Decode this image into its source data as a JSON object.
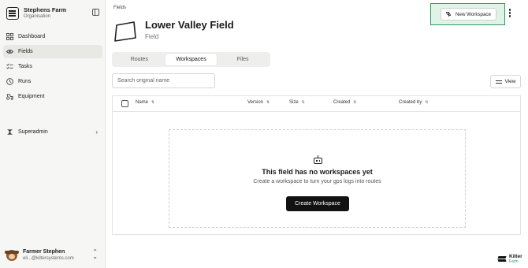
{
  "sidebar": {
    "org": {
      "name": "Stephens Farm",
      "subtitle": "Organisation"
    },
    "nav": [
      {
        "label": "Dashboard",
        "icon": "dashboard-grid-icon",
        "active": false
      },
      {
        "label": "Fields",
        "icon": "eye-field-icon",
        "active": true
      },
      {
        "label": "Tasks",
        "icon": "tasks-list-icon",
        "active": false
      },
      {
        "label": "Runs",
        "icon": "clock-icon",
        "active": false
      },
      {
        "label": "Equipment",
        "icon": "tractor-icon",
        "active": false
      }
    ],
    "superadmin": {
      "label": "Superadmin"
    },
    "user": {
      "name": "Farmer Stephen",
      "email": "eli...@kiltersystems.com"
    }
  },
  "breadcrumb": "Fields",
  "header": {
    "title": "Lower Valley Field",
    "subtitle": "Field"
  },
  "actions": {
    "new_workspace": "New Workspace"
  },
  "tabs": [
    {
      "label": "Routes",
      "active": false
    },
    {
      "label": "Workspaces",
      "active": true
    },
    {
      "label": "Files",
      "active": false
    }
  ],
  "search": {
    "placeholder": "Search original name",
    "value": ""
  },
  "view_button": "View",
  "table": {
    "columns": [
      "Name",
      "Version",
      "Size",
      "Created",
      "Created by"
    ]
  },
  "empty_state": {
    "title": "This field has no workspaces yet",
    "subtitle": "Create a workspace to turn your gps logs into routes",
    "button": "Create Workspace"
  },
  "brand": {
    "name": "Kilter",
    "sub": "Farm"
  },
  "colors": {
    "accent_green": "#2f9a62",
    "highlight_bg": "#dff3e7",
    "primary_dark": "#111111"
  }
}
